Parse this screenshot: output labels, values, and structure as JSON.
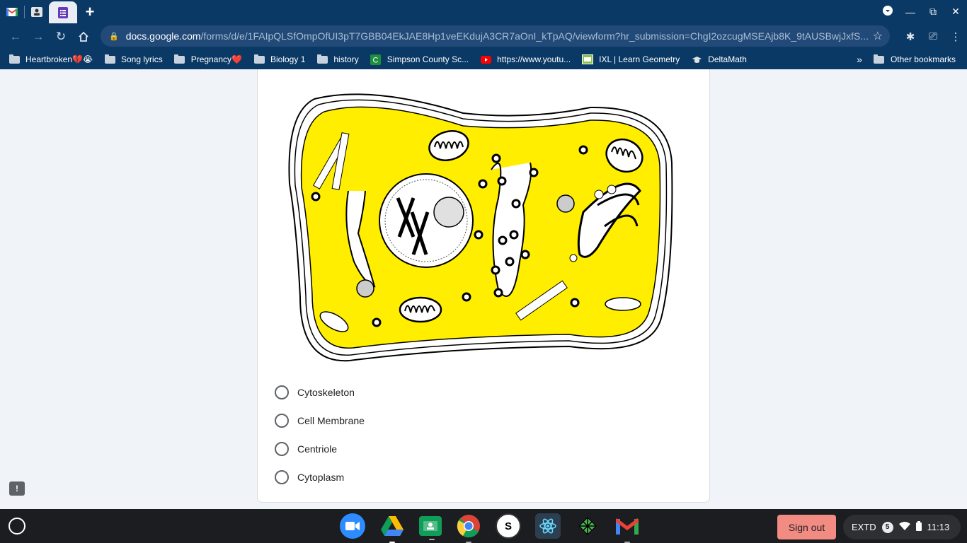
{
  "browser": {
    "tabs": [
      {
        "icon": "gmail-icon"
      },
      {
        "icon": "contact-icon"
      },
      {
        "icon": "forms-icon",
        "active": true
      }
    ],
    "new_tab": "+",
    "url_host": "docs.google.com",
    "url_path": "/forms/d/e/1FAIpQLSfOmpOfUI3pT7GBB04EkJAE8Hp1veEKdujA3CR7aOnI_kTpAQ/viewform?hr_submission=ChgI2ozcugMSEAjb8K_9tAUSBwjJxfS..."
  },
  "bookmarks": {
    "items": [
      {
        "label": "Heartbroken💔😭",
        "icon": "folder-icon"
      },
      {
        "label": "Song lyrics",
        "icon": "folder-icon"
      },
      {
        "label": "Pregnancy❤️",
        "icon": "folder-icon"
      },
      {
        "label": "Biology 1",
        "icon": "folder-icon"
      },
      {
        "label": "history",
        "icon": "folder-icon"
      },
      {
        "label": "Simpson County Sc...",
        "icon": "classroom-icon"
      },
      {
        "label": "https://www.youtu...",
        "icon": "youtube-icon"
      },
      {
        "label": "IXL | Learn Geometry",
        "icon": "ixl-icon"
      },
      {
        "label": "DeltaMath",
        "icon": "deltamath-icon"
      }
    ],
    "overflow": "»",
    "other": "Other bookmarks"
  },
  "form": {
    "options": [
      {
        "label": "Cytoskeleton"
      },
      {
        "label": "Cell Membrane"
      },
      {
        "label": "Centriole"
      },
      {
        "label": "Cytoplasm"
      }
    ],
    "feedback": "!"
  },
  "shelf": {
    "sign_out": "Sign out",
    "tray_label": "EXTD",
    "notification_count": "5",
    "time": "11:13"
  },
  "colors": {
    "chrome_frame": "#0b3966",
    "cytoplasm": "#ffee00",
    "sign_out": "#f28b82"
  }
}
